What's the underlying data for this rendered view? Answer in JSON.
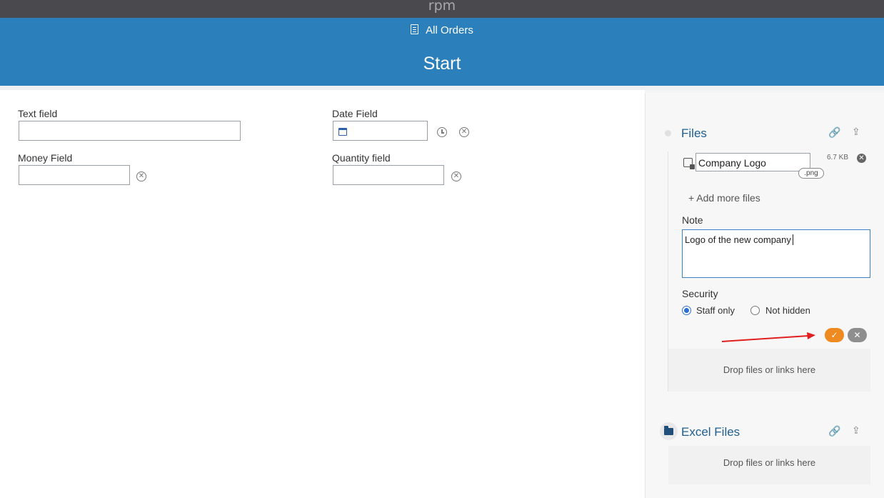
{
  "topbar": {
    "brand": "rpm"
  },
  "header": {
    "nav_label": "All Orders",
    "title": "Start"
  },
  "form": {
    "text_field_label": "Text field",
    "date_field_label": "Date Field",
    "money_field_label": "Money Field",
    "quantity_field_label": "Quantity field"
  },
  "files": {
    "title": "Files",
    "file": {
      "name": "Company Logo",
      "extension": ".png",
      "size": "6.7 KB"
    },
    "add_more": "+ Add more files",
    "note_label": "Note",
    "note_value": "Logo of the new company",
    "security_label": "Security",
    "security_options": [
      {
        "label": "Staff only",
        "selected": true
      },
      {
        "label": "Not hidden",
        "selected": false
      }
    ],
    "drop_text": "Drop files or links here"
  },
  "excel_files": {
    "title": "Excel Files",
    "drop_text": "Drop files or links here"
  },
  "colors": {
    "header": "#2b7fbb",
    "topbar": "#4a4a4e",
    "confirm": "#ee8a1f",
    "cancel": "#8e8e8e",
    "annotation_arrow": "#e02020"
  }
}
